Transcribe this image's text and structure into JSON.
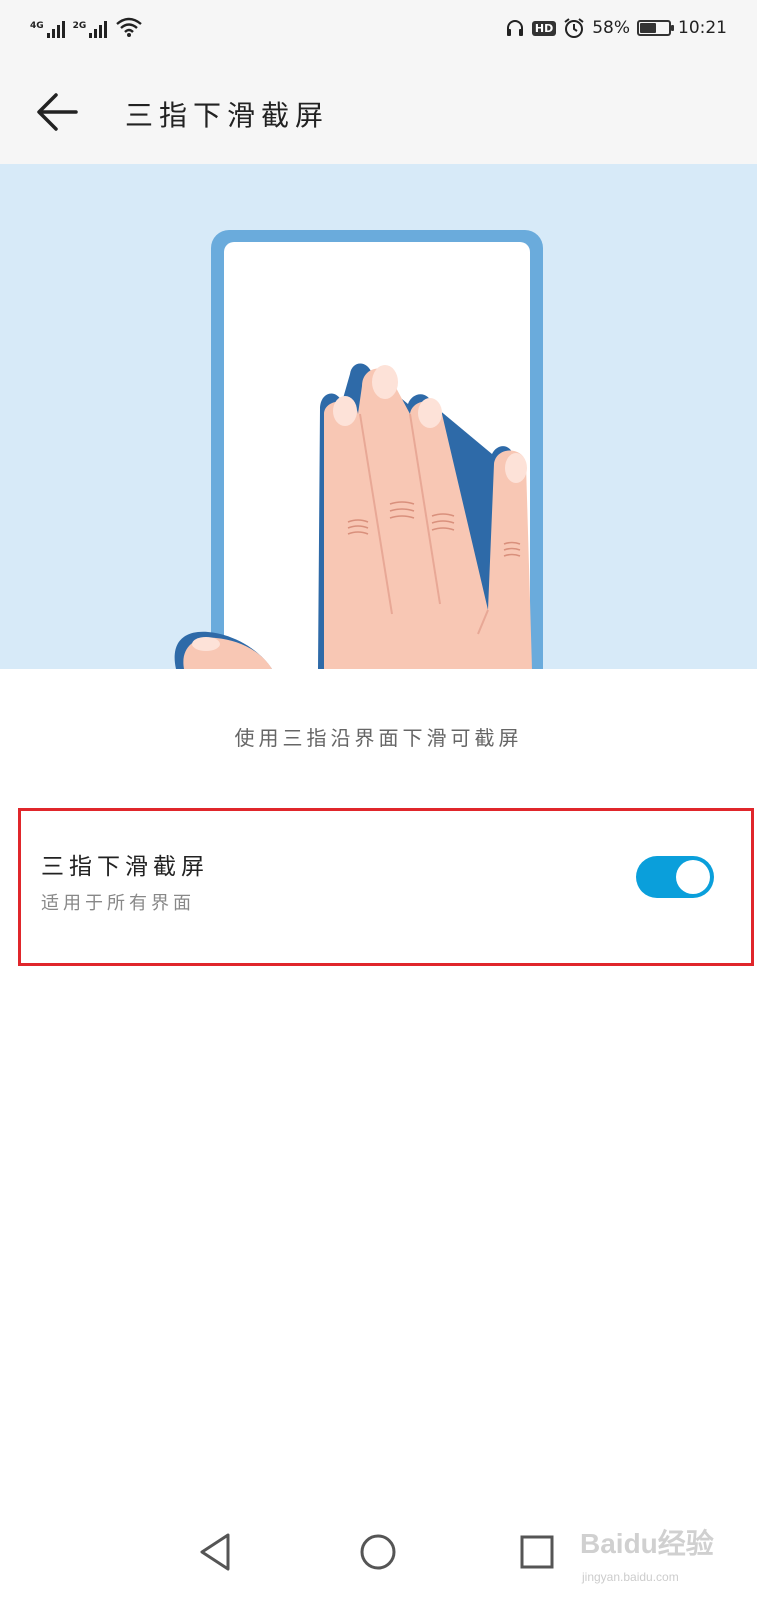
{
  "status_bar": {
    "signal1_label": "4G",
    "signal2_label": "2G",
    "hd_label": "HD",
    "battery_percent": "58%",
    "battery_level": 0.58,
    "time": "10:21"
  },
  "header": {
    "title": "三指下滑截屏"
  },
  "main": {
    "description": "使用三指沿界面下滑可截屏"
  },
  "setting": {
    "title": "三指下滑截屏",
    "subtitle": "适用于所有界面",
    "toggle_on": true
  },
  "watermark": {
    "brand": "Baidu经验",
    "url": "jingyan.baidu.com"
  },
  "colors": {
    "accent": "#0a9fdb",
    "highlight_border": "#e0262b",
    "illustration_bg": "#d7eaf8",
    "phone_frame": "#6aabdc",
    "skin": "#f8c7b4"
  },
  "icons": {
    "back": "arrow-left-icon",
    "nav_back": "triangle-back-icon",
    "nav_home": "circle-home-icon",
    "nav_recents": "square-recents-icon",
    "wifi": "wifi-icon",
    "headphones": "headphones-icon",
    "alarm": "alarm-icon"
  }
}
